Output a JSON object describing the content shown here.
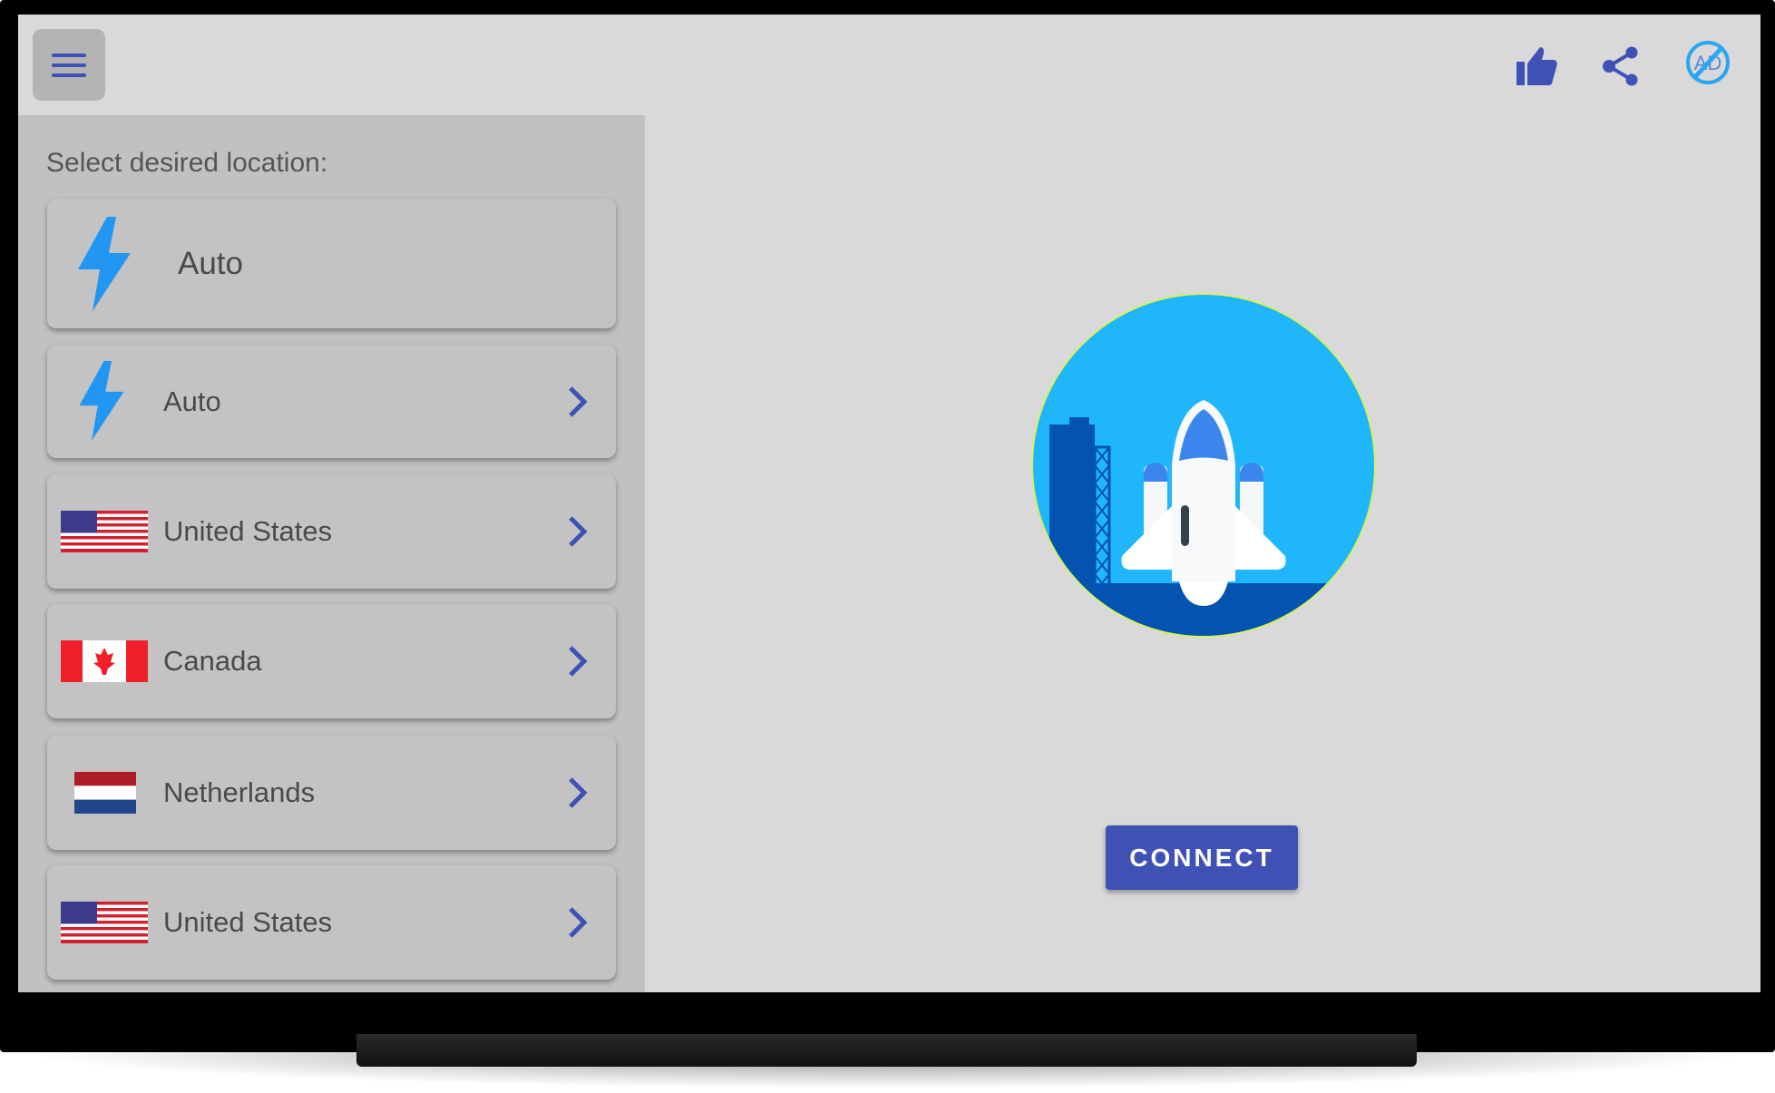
{
  "header": {
    "menu_icon": "hamburger-menu-icon",
    "actions": [
      {
        "name": "rate",
        "icon": "thumbs-up-icon"
      },
      {
        "name": "share",
        "icon": "share-icon"
      },
      {
        "name": "remove-ads",
        "icon": "no-ads-icon",
        "text": "AD"
      }
    ]
  },
  "locations": {
    "label": "Select desired location:",
    "items": [
      {
        "name": "Auto",
        "icon": "lightning-icon",
        "selected": true
      },
      {
        "name": "Auto",
        "icon": "lightning-icon"
      },
      {
        "name": "United States",
        "icon": "us-flag-icon"
      },
      {
        "name": "Canada",
        "icon": "canada-flag-icon"
      },
      {
        "name": "Netherlands",
        "icon": "netherlands-flag-icon"
      },
      {
        "name": "United States",
        "icon": "us-flag-icon"
      }
    ]
  },
  "main": {
    "illustration": "rocket-launch-icon",
    "connect_label": "CONNECT"
  },
  "colors": {
    "accent": "#3f51b5",
    "sky": "#1fb6fc",
    "ground": "#0353b0",
    "panel": "#c1c1c1",
    "background": "#d9d9d9"
  }
}
